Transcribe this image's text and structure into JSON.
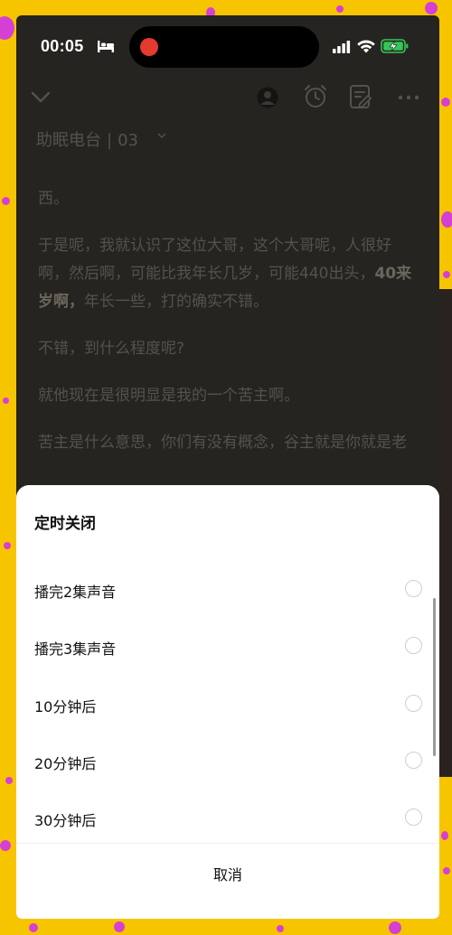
{
  "status_bar": {
    "time": "00:05",
    "icons": [
      "bed-icon",
      "recording-dot",
      "signal-icon",
      "wifi-icon",
      "battery-charging-icon"
    ]
  },
  "nav": {
    "icons": [
      "chevron-down-icon",
      "avatar",
      "alarm-clock-icon",
      "edit-icon",
      "more-icon"
    ]
  },
  "episode": {
    "name": "助眠电台",
    "separator": "|",
    "number": "03"
  },
  "article": {
    "p1": "西。",
    "p2_a": "于是呢，我就认识了这位大哥，这个大哥呢，人很好啊，然后啊，可能比我年长几岁，可能440出头，",
    "p2_bold": "40来岁啊，",
    "p2_b": "年长一些，打的确实不错。",
    "p3": "不错，到什么程度呢?",
    "p4": "就他现在是很明显是我的一个苦主啊。",
    "p5": "苦主是什么意思，你们有没有概念，谷主就是你就是老"
  },
  "sheet": {
    "title": "定时关闭",
    "options": [
      {
        "label": "播完2集声音",
        "selected": false
      },
      {
        "label": "播完3集声音",
        "selected": false
      },
      {
        "label": "10分钟后",
        "selected": false
      },
      {
        "label": "20分钟后",
        "selected": false
      },
      {
        "label": "30分钟后",
        "selected": false
      }
    ],
    "cancel_label": "取消"
  },
  "colors": {
    "background_frame": "#f7c400",
    "confetti": "#d63fd3",
    "app_background": "#262420",
    "record_dot": "#e53a2e",
    "battery_fill": "#34c759"
  }
}
